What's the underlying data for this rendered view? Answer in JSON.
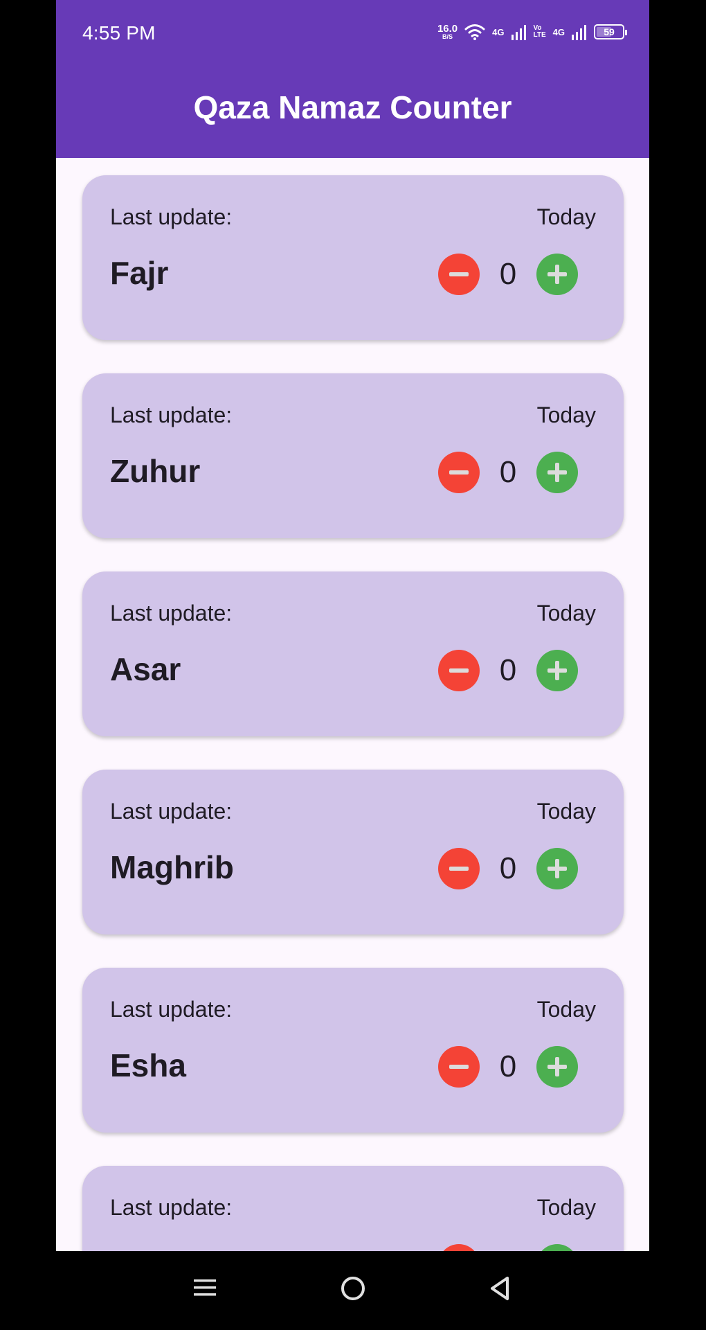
{
  "status_bar": {
    "time": "4:55 PM",
    "net_speed_value": "16.0",
    "net_speed_unit": "B/S",
    "sim1_label": "4G",
    "volte_top": "Vo",
    "volte_bottom": "LTE",
    "sim2_label": "4G",
    "battery_level": "59",
    "battery_fraction": 0.59
  },
  "app_bar": {
    "title": "Qaza Namaz Counter",
    "color": "#673ab7"
  },
  "cards": [
    {
      "label": "Last update:",
      "date": "Today",
      "name": "Fajr",
      "count": "0"
    },
    {
      "label": "Last update:",
      "date": "Today",
      "name": "Zuhur",
      "count": "0"
    },
    {
      "label": "Last update:",
      "date": "Today",
      "name": "Asar",
      "count": "0"
    },
    {
      "label": "Last update:",
      "date": "Today",
      "name": "Maghrib",
      "count": "0"
    },
    {
      "label": "Last update:",
      "date": "Today",
      "name": "Esha",
      "count": "0"
    },
    {
      "label": "Last update:",
      "date": "Today",
      "name": "",
      "count": ""
    }
  ],
  "colors": {
    "card_bg": "#d1c4e9",
    "decrement": "#f44336",
    "increment": "#4caf50",
    "page_bg": "#fdf7fe"
  },
  "nav_bar": {
    "menu_icon": "menu-icon",
    "home_icon": "home-circle-icon",
    "back_icon": "back-triangle-icon"
  }
}
